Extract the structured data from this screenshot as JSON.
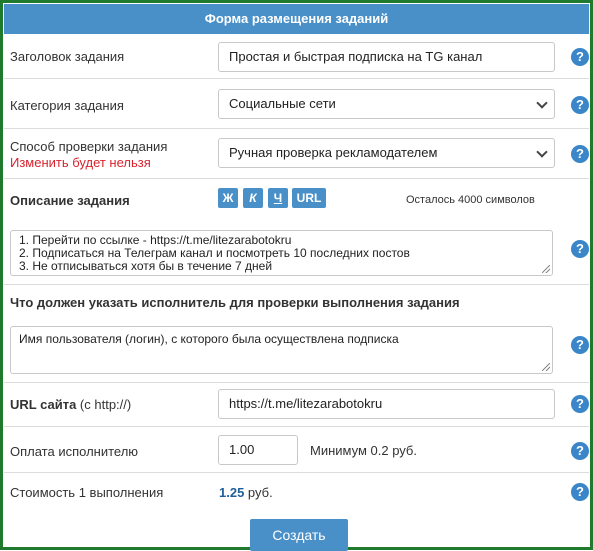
{
  "form": {
    "title": "Форма размещения заданий",
    "task_title": {
      "label": "Заголовок задания",
      "value": "Простая и быстрая подписка на TG канал"
    },
    "category": {
      "label": "Категория задания",
      "value": "Социальные сети"
    },
    "verification": {
      "label": "Способ проверки задания",
      "note": "Изменить будет нельзя",
      "value": "Ручная проверка рекламодателем"
    },
    "description": {
      "label": "Описание задания",
      "buttons": {
        "bold": "Ж",
        "italic": "К",
        "underline": "Ч",
        "url": "URL"
      },
      "counter": "Осталось 4000 символов",
      "lines": [
        "1. Перейти по ссылке - https://t.me/litezarabotokru",
        "2. Подписаться на Телеграм канал и посмотреть 10 последних постов",
        "3. Не отписываться хотя бы в течение 7 дней"
      ]
    },
    "proof": {
      "label": "Что должен указать исполнитель для проверки выполнения задания",
      "value": "Имя пользователя (логин), с которого была осуществлена подписка"
    },
    "url": {
      "label_bold": "URL сайта",
      "label_suffix": " (с http://)",
      "value": "https://t.me/litezarabotokru"
    },
    "payment": {
      "label": "Оплата исполнителю",
      "value": "1.00",
      "min_note": "Минимум 0.2 руб."
    },
    "cost": {
      "label": "Стоимость 1 выполнения",
      "value": "1.25",
      "unit": " руб."
    },
    "help_glyph": "?",
    "submit_label": "Создать"
  },
  "colors": {
    "header": "#4a90c8",
    "border": "#1f7a2e",
    "warning": "#d9232e",
    "help": "#3a86c8",
    "value_accent": "#1f5f99"
  }
}
